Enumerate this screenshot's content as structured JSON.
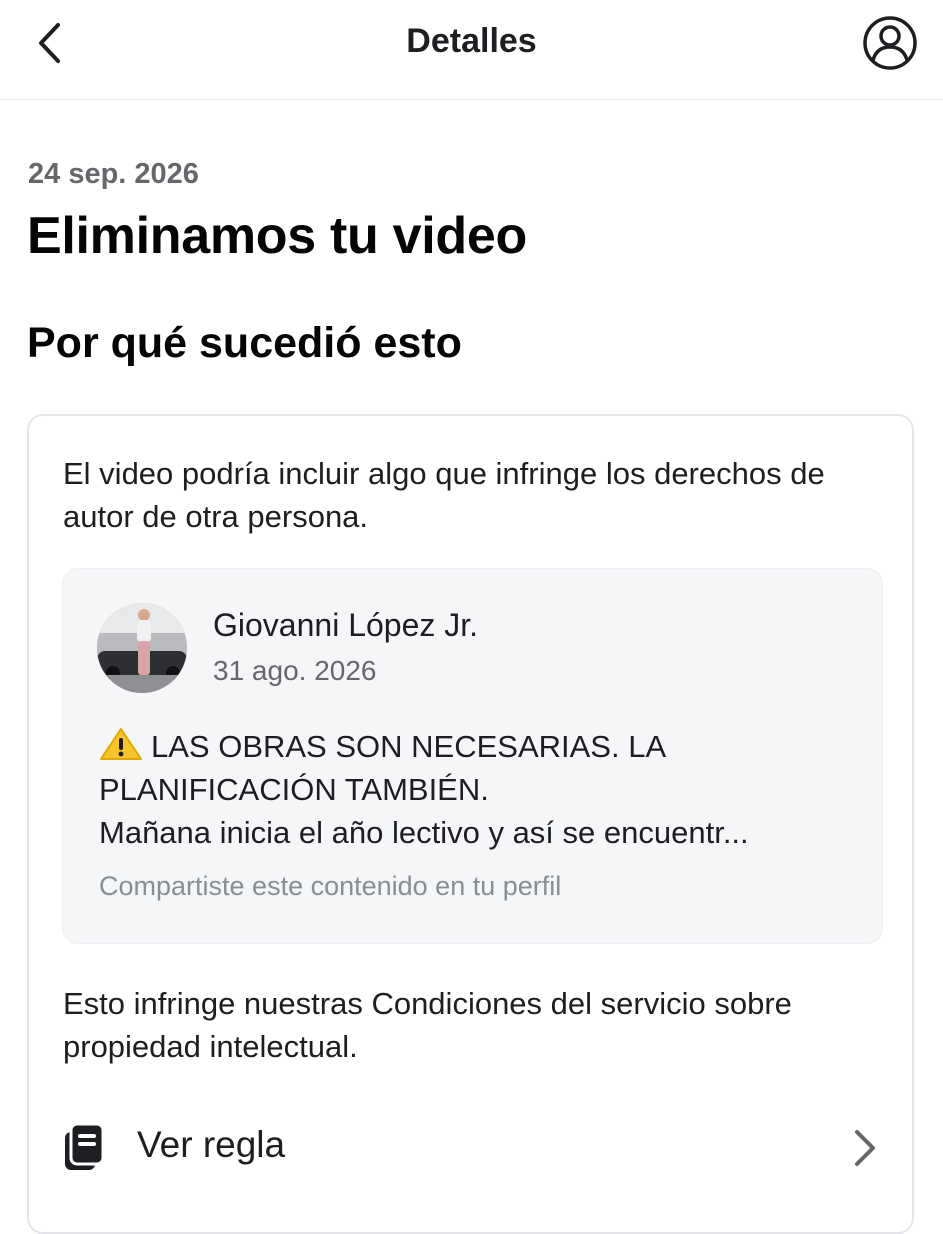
{
  "header": {
    "title": "Detalles",
    "back_icon": "chevron-left-icon",
    "profile_icon": "user-circle-icon"
  },
  "notice": {
    "date": "24 sep. 2026",
    "headline": "Eliminamos tu video",
    "section_title": "Por qué sucedió esto"
  },
  "card": {
    "reason": "El video podría incluir algo que infringe los derechos de autor de otra persona.",
    "post": {
      "author": "Giovanni López Jr.",
      "date": "31 ago. 2026",
      "warning_icon": "warning-icon",
      "text_line1": "LAS OBRAS SON NECESARIAS. LA PLANIFICACIÓN TAMBIÉN.",
      "text_line2": "Mañana inicia el año lectivo y así se encuentr...",
      "note": "Compartiste este contenido en tu perfil"
    },
    "terms": "Esto infringe nuestras Condiciones del servicio sobre propiedad intelectual.",
    "rule": {
      "label": "Ver regla",
      "icon": "book-icon",
      "chevron": "chevron-right-icon"
    }
  },
  "colors": {
    "text_primary": "#1c1e21",
    "text_secondary": "#65676b",
    "note_gray": "#8a8d91",
    "post_background": "#f5f6f7",
    "warning_yellow": "#f7c52b"
  }
}
